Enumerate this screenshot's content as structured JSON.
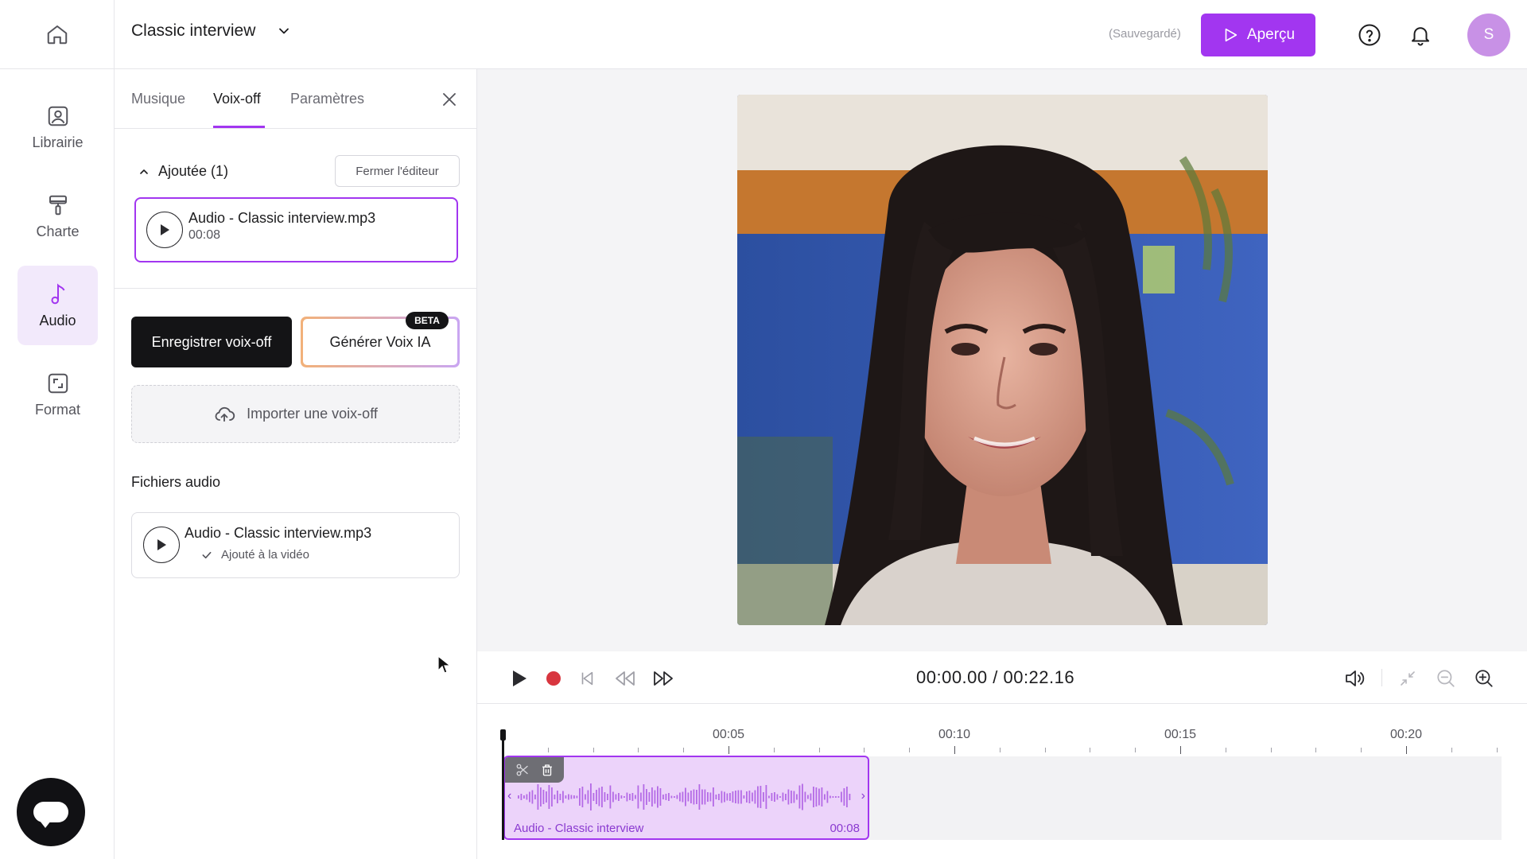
{
  "header": {
    "project_title": "Classic interview",
    "save_status": "(Sauvegardé)",
    "preview_label": "Aperçu",
    "avatar_initial": "S",
    "accent_color": "#a236f0"
  },
  "rail": {
    "items": [
      {
        "label": "Librairie",
        "icon": "image-library-icon"
      },
      {
        "label": "Charte",
        "icon": "paint-roller-icon"
      },
      {
        "label": "Audio",
        "icon": "music-note-icon",
        "active": true
      },
      {
        "label": "Format",
        "icon": "aspect-ratio-icon"
      }
    ]
  },
  "panel": {
    "tabs": [
      {
        "label": "Musique"
      },
      {
        "label": "Voix-off",
        "active": true
      },
      {
        "label": "Paramètres"
      }
    ],
    "added_section": {
      "title": "Ajoutée (1)",
      "close_editor_label": "Fermer l'éditeur",
      "file": {
        "name": "Audio - Classic interview.mp3",
        "duration": "00:08"
      }
    },
    "record_label": "Enregistrer voix-off",
    "ai_label": "Générer Voix IA",
    "ai_badge": "BETA",
    "import_label": "Importer une voix-off",
    "files_title": "Fichiers audio",
    "files": [
      {
        "name": "Audio - Classic interview.mp3",
        "status": "Ajouté à la vidéo"
      }
    ]
  },
  "player": {
    "timecode": "00:00.00 / 00:22.16"
  },
  "timeline": {
    "ticks": [
      "00:05",
      "00:10",
      "00:15",
      "00:20"
    ],
    "clip": {
      "name": "Audio - Classic interview",
      "duration": "00:08"
    }
  }
}
